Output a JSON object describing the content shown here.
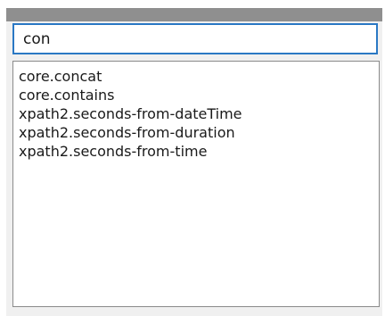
{
  "search": {
    "value": "con"
  },
  "results": {
    "items": [
      {
        "label": "core.concat"
      },
      {
        "label": "core.contains"
      },
      {
        "label": "xpath2.seconds-from-dateTime"
      },
      {
        "label": "xpath2.seconds-from-duration"
      },
      {
        "label": "xpath2.seconds-from-time"
      }
    ]
  },
  "colors": {
    "topbar": "#8f8f8f",
    "input_border_focus": "#2a78c4",
    "list_border": "#8a8a8a",
    "panel_bg": "#f0f0f0"
  }
}
